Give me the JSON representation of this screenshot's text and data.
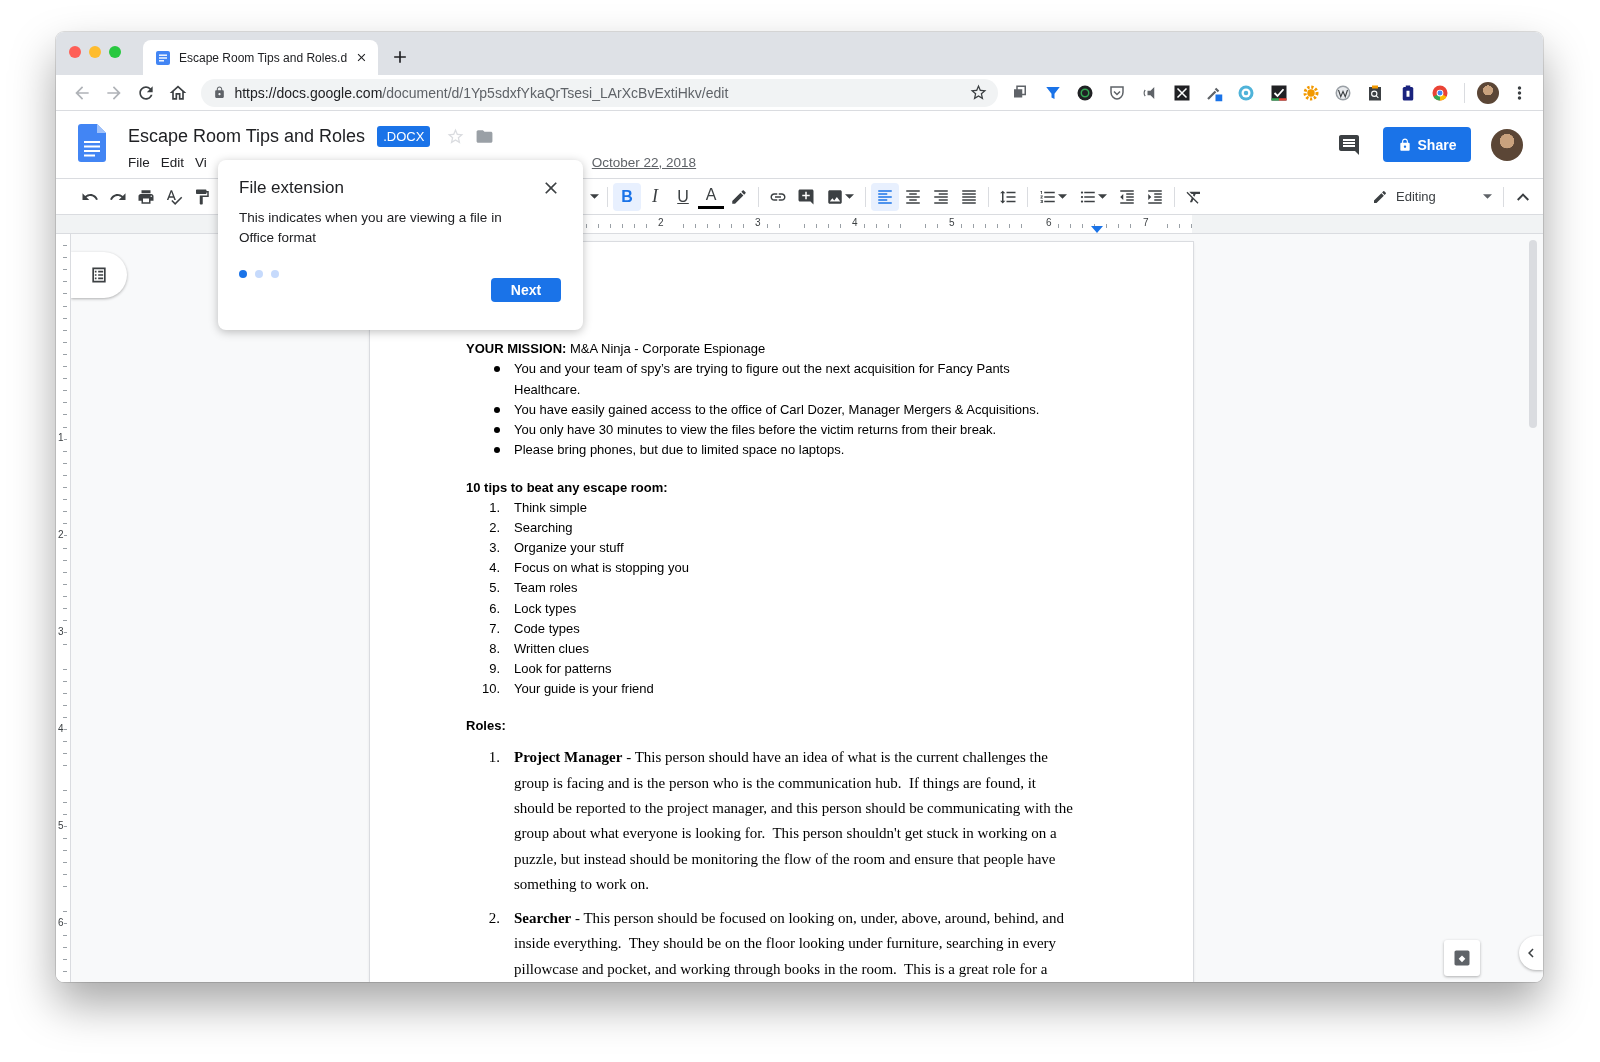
{
  "browser": {
    "tabs": [
      {
        "title": "Escape Room Tips and Roles.d",
        "selected": true
      }
    ],
    "url": {
      "host": "https://docs.google.com",
      "path": "/document/d/1Yp5sdxfYkaQrTsesi_LArXcBvExtiHkv/edit"
    }
  },
  "docs": {
    "title": "Escape Room Tips and Roles",
    "badge": ".DOCX",
    "menus": [
      "File",
      "Edit",
      "Vi"
    ],
    "last_edit": "October 22, 2018",
    "share": "Share",
    "mode": "Editing",
    "toolbar": [
      {
        "kind": "undo"
      },
      {
        "kind": "redo"
      },
      {
        "kind": "print"
      },
      {
        "kind": "spellcheck"
      },
      {
        "kind": "paint"
      },
      {
        "kind": "hidden"
      },
      {
        "kind": "caret"
      },
      {
        "kind": "sep"
      },
      {
        "kind": "bold",
        "glyph": "B",
        "selected": true
      },
      {
        "kind": "italic",
        "glyph": "I",
        "selected": false
      },
      {
        "kind": "underline",
        "glyph": "U",
        "selected": false
      },
      {
        "kind": "color",
        "glyph": "A"
      },
      {
        "kind": "highlight"
      },
      {
        "kind": "sep"
      },
      {
        "kind": "link"
      },
      {
        "kind": "comment"
      },
      {
        "kind": "image",
        "dropdown": true
      },
      {
        "kind": "sep"
      },
      {
        "kind": "left",
        "selected": true
      },
      {
        "kind": "center",
        "selected": false
      },
      {
        "kind": "right",
        "selected": false
      },
      {
        "kind": "justify",
        "selected": false
      },
      {
        "kind": "sep"
      },
      {
        "kind": "spacing"
      },
      {
        "kind": "sep"
      },
      {
        "kind": "numbered",
        "dropdown": true
      },
      {
        "kind": "bulleted",
        "dropdown": true
      },
      {
        "kind": "outdent"
      },
      {
        "kind": "indent"
      },
      {
        "kind": "sep"
      },
      {
        "kind": "clear"
      }
    ]
  },
  "ruler": {
    "marks": [
      "2",
      "3",
      "4",
      "5",
      "6",
      "7"
    ],
    "vertical_marks": [
      "1",
      "2",
      "3",
      "4",
      "5",
      "6"
    ]
  },
  "popup": {
    "title": "File extension",
    "body": "This indicates when you are viewing a file in Office format",
    "steps": [
      {
        "selected": true
      },
      {
        "selected": false
      },
      {
        "selected": false
      }
    ],
    "button": "Next"
  },
  "document": {
    "mission": "**YOUR MISSION:** M&A Ninja - Corporate Espionage",
    "bullets": [
      "You and your team of spy’s are trying to figure out the next acquisition for Fancy Pants Healthcare.",
      "You have easily gained access to the office of Carl Dozer, Manager Mergers & Acquisitions.",
      "You only have 30 minutes to view the files before the victim returns from their break.",
      "Please bring phones, but due to limited space no laptops."
    ],
    "tips_heading": "10 tips to beat any escape room:",
    "tips": [
      {
        "number": "1.",
        "text": "Think simple"
      },
      {
        "number": "2.",
        "text": "Searching"
      },
      {
        "number": "3.",
        "text": "Organize your stuff"
      },
      {
        "number": "4.",
        "text": "Focus on what is stopping you"
      },
      {
        "number": "5.",
        "text": "Team roles"
      },
      {
        "number": "6.",
        "text": "Lock types"
      },
      {
        "number": "7.",
        "text": "Code types"
      },
      {
        "number": "8.",
        "text": "Written clues"
      },
      {
        "number": "9.",
        "text": "Look for patterns"
      },
      {
        "number": "10.",
        "text": "Your guide is your friend"
      }
    ],
    "roles_heading": "Roles:",
    "roles": [
      {
        "number": "1.",
        "text": "**Project Manager** - This person should have an idea of what is the current challenges the group is facing and is the person who is the communication hub.  If things are found, it should be reported to the project manager, and this person should be communicating with the group about what everyone is looking for.  This person shouldn't get stuck in working on a puzzle, but instead should be monitoring the flow of the room and ensure that people have something to work on."
      },
      {
        "number": "2.",
        "text": "**Searcher** - This person should be focused on looking on, under, above, around, behind, and inside everything.  They should be on the floor looking under furniture, searching in every pillowcase and pocket, and working through books in the room.  This is a great role for a"
      }
    ]
  }
}
